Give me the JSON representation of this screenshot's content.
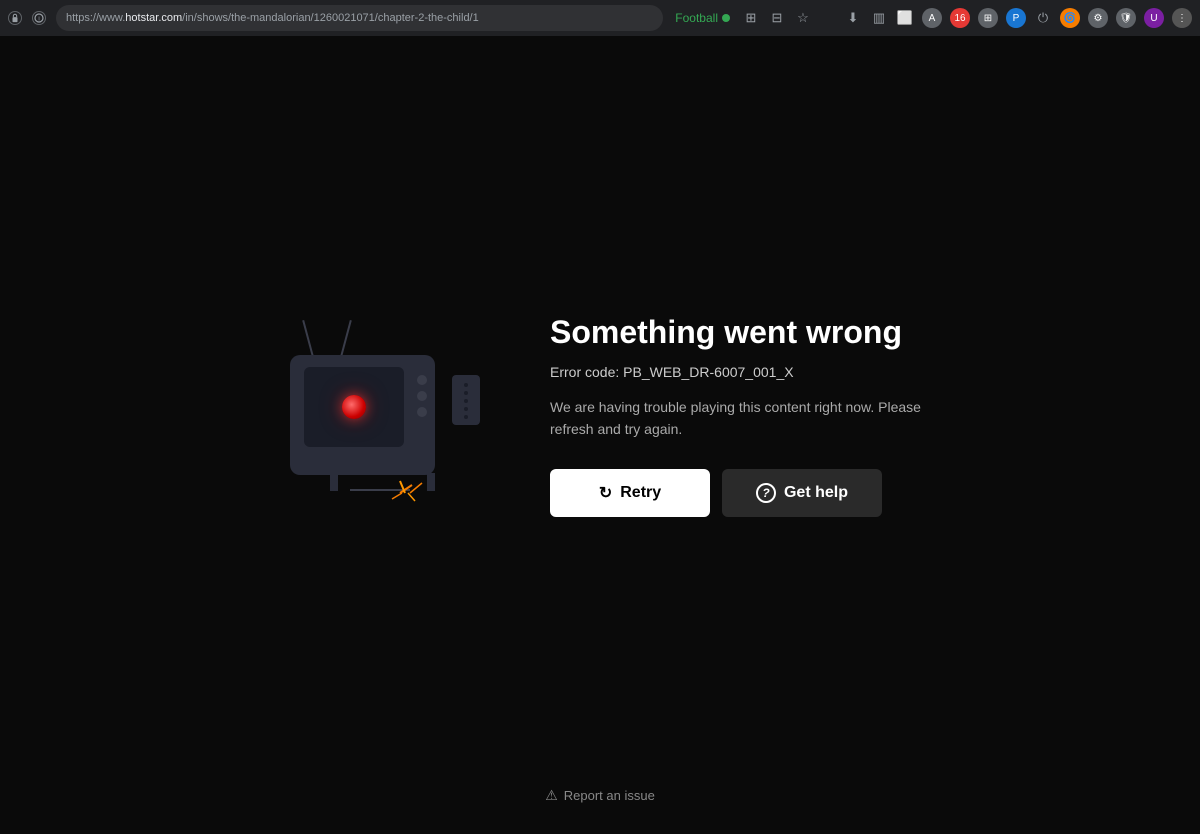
{
  "browser": {
    "url_prefix": "https://www.hotstar.com/in/shows/the-mandalorian/1260021071/chapter-2-the-child/1",
    "url_display_base": "hotstar.com",
    "url_display_full": "https://www.hotstar.com/in/shows/the-mandalorian/1260021071/chapter-2-the-child/1",
    "football_label": "Football",
    "football_dot_color": "#34a853"
  },
  "error_page": {
    "title": "Something went wrong",
    "error_code_label": "Error code: PB_WEB_DR-6007_001_X",
    "description": "We are having trouble playing this content right now. Please refresh and try again.",
    "retry_button": "Retry",
    "help_button": "Get help",
    "report_label": "Report an issue"
  },
  "colors": {
    "background": "#0a0a0a",
    "browser_bg": "#202124",
    "address_bar_bg": "#303134",
    "tv_body": "#2a2d3a",
    "tv_screen": "#1a1d28",
    "red_dot": "#cc0000",
    "retry_btn_bg": "#ffffff",
    "retry_btn_text": "#000000",
    "help_btn_bg": "#2a2a2a",
    "help_btn_text": "#ffffff"
  }
}
